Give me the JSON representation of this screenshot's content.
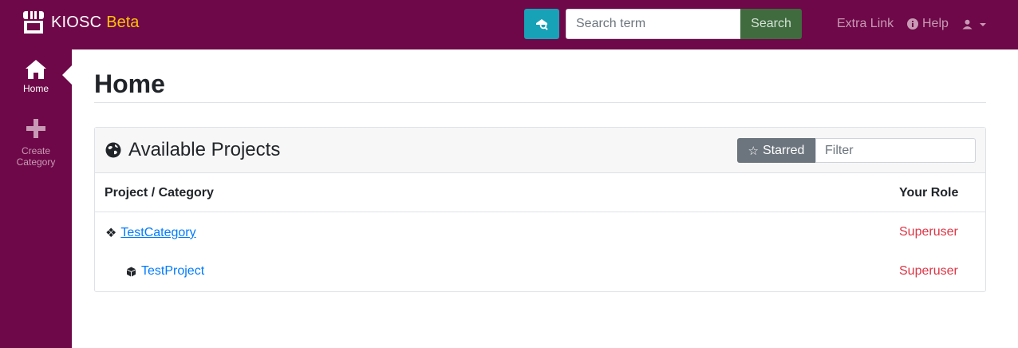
{
  "brand": {
    "name": "KIOSC",
    "beta": "Beta"
  },
  "search": {
    "placeholder": "Search term",
    "button_label": "Search"
  },
  "navbar": {
    "extra_link": "Extra Link",
    "help_label": "Help"
  },
  "sidebar": {
    "items": [
      {
        "label": "Home",
        "icon": "home-icon"
      },
      {
        "label": "Create Category",
        "icon": "plus-icon"
      }
    ]
  },
  "page": {
    "title": "Home"
  },
  "projects_card": {
    "title": "Available Projects",
    "starred_label": "Starred",
    "filter_placeholder": "Filter",
    "columns": [
      "Project / Category",
      "Your Role"
    ],
    "rows": [
      {
        "type": "category",
        "name": "TestCategory",
        "role": "Superuser"
      },
      {
        "type": "project",
        "name": "TestProject",
        "role": "Superuser"
      }
    ]
  },
  "colors": {
    "brand_purple": "#6e0848",
    "beta_accent": "#ffc107",
    "adv_search_btn": "#17a2b8",
    "search_btn": "#3f6b3f",
    "link": "#007bff",
    "role": "#dc3545"
  }
}
